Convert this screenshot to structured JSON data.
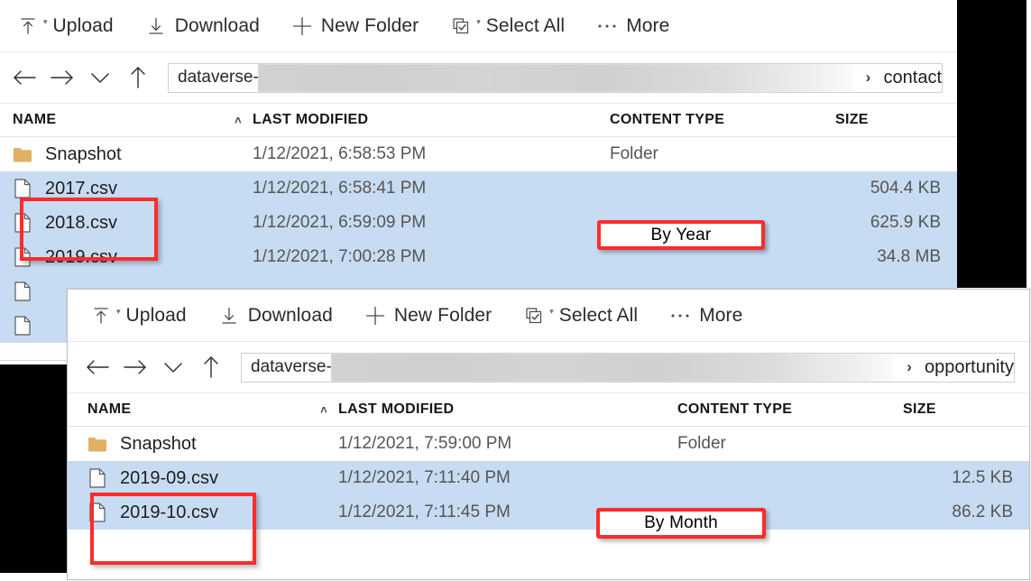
{
  "toolbar": {
    "upload_label": "Upload",
    "download_label": "Download",
    "new_folder_label": "New Folder",
    "select_all_label": "Select All",
    "more_label": "More",
    "caret_glyph": "▾",
    "more_glyph": "⋯"
  },
  "nav": {
    "back_title": "Back",
    "forward_title": "Forward",
    "recent_title": "Recent locations",
    "up_title": "Up one level",
    "separator_glyph": "›"
  },
  "columns": {
    "name": "NAME",
    "last_modified": "LAST MODIFIED",
    "content_type": "CONTENT TYPE",
    "size": "SIZE",
    "sort_caret": "˄"
  },
  "colors": {
    "selection": "#c7dcf2",
    "annotation": "#fb2c2c",
    "folder": "#e0b163",
    "mask": "#000000"
  },
  "panels": [
    {
      "id": "contact",
      "breadcrumb": {
        "root": "dataverse-",
        "redacted": true,
        "leaf": "contact"
      },
      "rows": [
        {
          "icon": "folder-icon",
          "name": "Snapshot",
          "last_modified": "1/12/2021, 6:58:53 PM",
          "content_type": "Folder",
          "size": "",
          "selected": false
        },
        {
          "icon": "file-icon",
          "name": "2017.csv",
          "last_modified": "1/12/2021, 6:58:41 PM",
          "content_type": "",
          "size": "504.4 KB",
          "selected": true
        },
        {
          "icon": "file-icon",
          "name": "2018.csv",
          "last_modified": "1/12/2021, 6:59:09 PM",
          "content_type": "",
          "size": "625.9 KB",
          "selected": true
        },
        {
          "icon": "file-icon",
          "name": "2019.csv",
          "last_modified": "1/12/2021, 7:00:28 PM",
          "content_type": "",
          "size": "34.8 MB",
          "selected": true
        },
        {
          "icon": "file-icon",
          "name": "",
          "last_modified": "",
          "content_type": "",
          "size": "",
          "selected": true
        },
        {
          "icon": "file-icon",
          "name": "",
          "last_modified": "",
          "content_type": "",
          "size": "",
          "selected": true
        }
      ]
    },
    {
      "id": "opportunity",
      "breadcrumb": {
        "root": "dataverse-",
        "redacted": true,
        "leaf": "opportunity"
      },
      "rows": [
        {
          "icon": "folder-icon",
          "name": "Snapshot",
          "last_modified": "1/12/2021, 7:59:00 PM",
          "content_type": "Folder",
          "size": "",
          "selected": false
        },
        {
          "icon": "file-icon",
          "name": "2019-09.csv",
          "last_modified": "1/12/2021, 7:11:40 PM",
          "content_type": "",
          "size": "12.5 KB",
          "selected": true
        },
        {
          "icon": "file-icon",
          "name": "2019-10.csv",
          "last_modified": "1/12/2021, 7:11:45 PM",
          "content_type": "",
          "size": "86.2 KB",
          "selected": true
        }
      ]
    }
  ],
  "annotations": {
    "by_year_label": "By Year",
    "by_month_label": "By Month"
  }
}
